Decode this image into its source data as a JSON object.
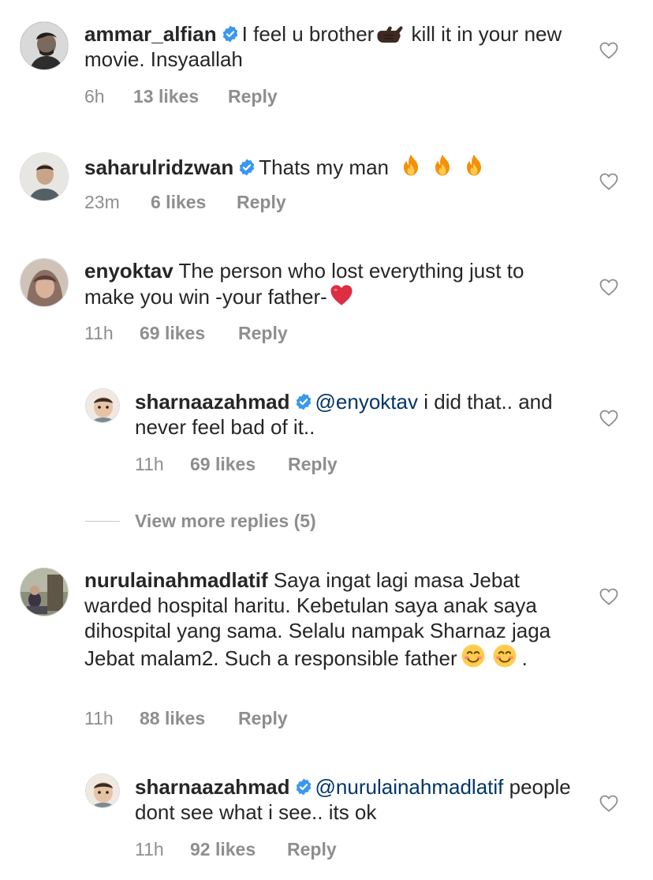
{
  "comments": [
    {
      "username": "ammar_alfian",
      "verified": true,
      "text_a": "I feel u brother",
      "text_b": " kill it in your new movie. Insyaallah",
      "time": "6h",
      "likes": "13 likes",
      "reply": "Reply",
      "emoji": "call-me-hand-dark"
    },
    {
      "username": "saharulridzwan",
      "verified": true,
      "text": "Thats my man",
      "time": "23m",
      "likes": "6 likes",
      "reply": "Reply",
      "emoji": "fire x3"
    },
    {
      "username": "enyoktav",
      "verified": false,
      "text": "The person who lost everything just to make you win -your father-",
      "time": "11h",
      "likes": "69 likes",
      "reply": "Reply",
      "emoji": "red-heart"
    },
    {
      "username": "sharnaazahmad",
      "verified": true,
      "mention": "@enyoktav",
      "text": "i did that.. and never feel bad of it..",
      "time": "11h",
      "likes": "69 likes",
      "reply": "Reply"
    },
    {
      "username": "nurulainahmadlatif",
      "verified": false,
      "text": "Saya ingat lagi masa Jebat warded hospital haritu. Kebetulan saya anak saya dihospital yang sama. Selalu nampak Sharnaz jaga Jebat malam2. Such a responsible father",
      "tail": ".",
      "time": "11h",
      "likes": "88 likes",
      "reply": "Reply",
      "emoji": "smiling-face x2"
    },
    {
      "username": "sharnaazahmad",
      "verified": true,
      "mention": "@nurulainahmadlatif",
      "text": "people dont see what i see.. its ok",
      "time": "11h",
      "likes": "92 likes",
      "reply": "Reply"
    }
  ],
  "view_more": "View more replies (5)",
  "colors": {
    "text": "#262626",
    "meta": "#8e8e8e",
    "mention": "#003569",
    "verified": "#3897f0",
    "heart_outline": "#8e8e8e"
  }
}
